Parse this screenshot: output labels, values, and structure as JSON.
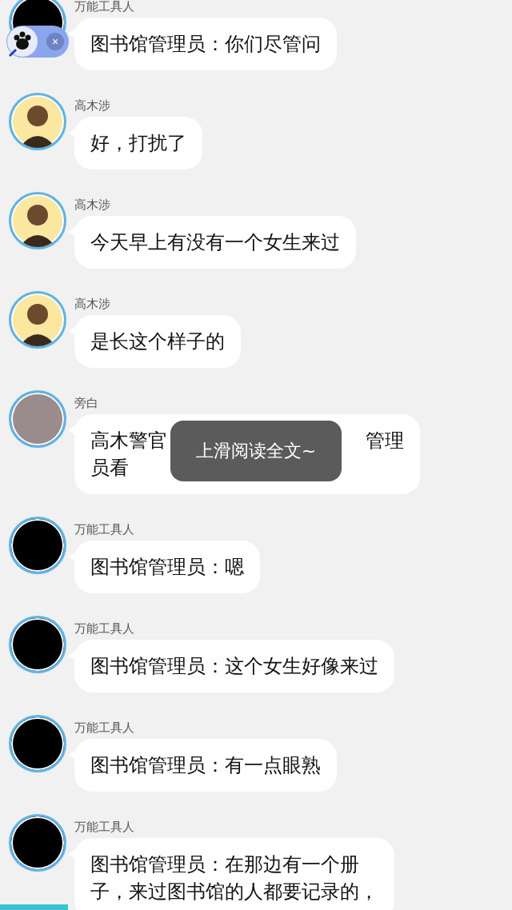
{
  "messages": [
    {
      "sender": "万能工具人",
      "avatar": {
        "kind": "dark"
      },
      "lines": [
        [
          "图书馆管理员：你们尽管问"
        ]
      ]
    },
    {
      "sender": "高木涉",
      "avatar": {
        "kind": "figure"
      },
      "lines": [
        [
          "好，打扰了"
        ]
      ]
    },
    {
      "sender": "高木涉",
      "avatar": {
        "kind": "figure"
      },
      "lines": [
        [
          "今天早上有没有一个女生来过"
        ]
      ]
    },
    {
      "sender": "高木涉",
      "avatar": {
        "kind": "figure"
      },
      "lines": [
        [
          "是长这个样子的"
        ]
      ]
    },
    {
      "sender": "旁白",
      "avatar": {
        "kind": "plain",
        "color": "#9a8b8d"
      },
      "lines": [
        [
          "高木警官",
          "管理"
        ],
        [
          "员看"
        ]
      ]
    },
    {
      "sender": "万能工具人",
      "avatar": {
        "kind": "dark"
      },
      "lines": [
        [
          "图书馆管理员：嗯"
        ]
      ]
    },
    {
      "sender": "万能工具人",
      "avatar": {
        "kind": "dark"
      },
      "lines": [
        [
          "图书馆管理员：这个女生好像来过"
        ]
      ]
    },
    {
      "sender": "万能工具人",
      "avatar": {
        "kind": "dark"
      },
      "lines": [
        [
          "图书馆管理员：有一点眼熟"
        ]
      ]
    },
    {
      "sender": "万能工具人",
      "avatar": {
        "kind": "dark"
      },
      "lines": [
        [
          "图书馆管理员：在那边有一个册"
        ],
        [
          "子，来过图书馆的人都要记录的，"
        ]
      ]
    }
  ],
  "toast": {
    "text": "上滑阅读全文~"
  },
  "floating_widget": {
    "close": "×"
  }
}
